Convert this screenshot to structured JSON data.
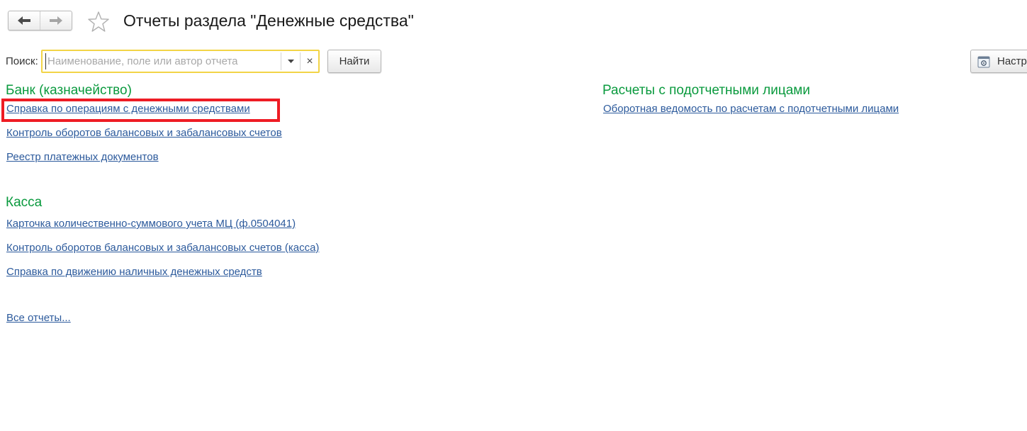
{
  "header": {
    "back_icon": "arrow-left-icon",
    "forward_icon": "arrow-right-icon",
    "favorite_icon": "star-icon",
    "title": "Отчеты раздела \"Денежные средства\""
  },
  "search": {
    "label": "Поиск:",
    "value": "",
    "placeholder": "Наименование, поле или автор отчета",
    "dropdown_icon": "triangle-down-icon",
    "clear_glyph": "×",
    "find_label": "Найти"
  },
  "settings": {
    "icon": "settings-icon",
    "label": "Настр"
  },
  "sections": {
    "bank": {
      "heading": "Банк (казначейство)",
      "links": [
        "Справка по операциям с денежными средствами",
        "Контроль оборотов балансовых и забалансовых счетов",
        "Реестр платежных документов"
      ]
    },
    "cash": {
      "heading": "Касса",
      "links": [
        "Карточка количественно-суммового учета МЦ  (ф.0504041)",
        "Контроль оборотов балансовых и забалансовых счетов (касса)",
        "Справка по движению наличных денежных средств"
      ]
    },
    "accountable": {
      "heading": "Расчеты с подотчетными лицами",
      "links": [
        "Оборотная ведомость по расчетам с подотчетными лицами"
      ]
    }
  },
  "all_reports_label": "Все отчеты...",
  "colors": {
    "heading": "#0a9a3e",
    "link": "#2c5a9c",
    "highlight": "#ee1c24",
    "search_border": "#f2d447"
  }
}
